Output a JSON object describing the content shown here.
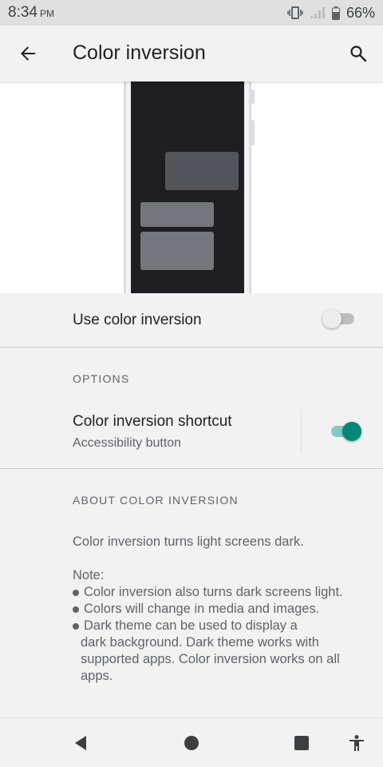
{
  "status_bar": {
    "time": "8:34",
    "ampm": "PM",
    "battery_percent": "66%",
    "icons": [
      "vibrate-icon",
      "signal-icon",
      "battery-icon"
    ]
  },
  "app_bar": {
    "title": "Color inversion",
    "back_icon": "arrow-back-icon",
    "search_icon": "search-icon"
  },
  "illustration": {
    "screen_color": "#1f1f23",
    "fab_color": "#669df6"
  },
  "use_color_inversion": {
    "label": "Use color inversion",
    "enabled": false
  },
  "options": {
    "header": "OPTIONS",
    "shortcut": {
      "title": "Color inversion shortcut",
      "subtitle": "Accessibility button",
      "enabled": true
    }
  },
  "about": {
    "header": "ABOUT COLOR INVERSION",
    "intro": "Color inversion turns light screens dark.",
    "note_label": "Note:",
    "bullets": [
      "Color inversion also turns dark screens light.",
      "Colors will change in media and images.",
      "Dark theme can be used to display a"
    ],
    "bullet_continuation": [
      "dark background. Dark theme works with",
      "supported apps. Color inversion works on all",
      "apps."
    ]
  },
  "nav_bar": {
    "buttons": [
      "back-icon",
      "home-icon",
      "recents-icon",
      "accessibility-icon"
    ]
  },
  "colors": {
    "accent": "#00897b",
    "accent_track": "#80cbc4",
    "off_thumb": "#ececec",
    "off_track": "#bdbdbd"
  }
}
